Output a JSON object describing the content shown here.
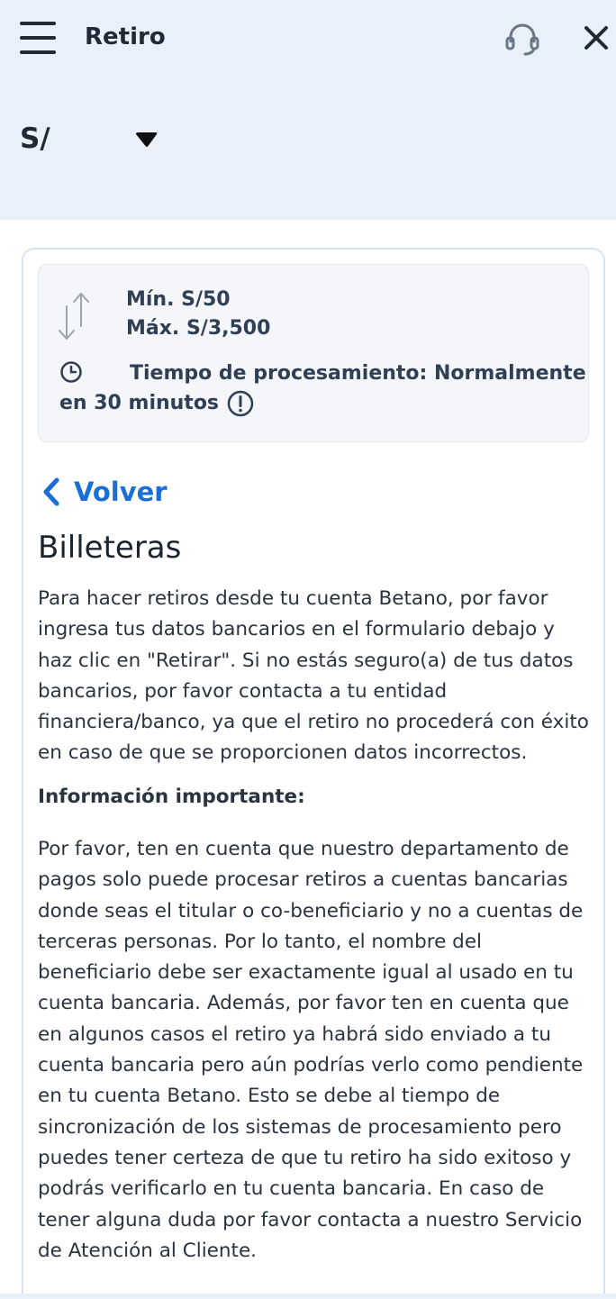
{
  "header": {
    "title": "Retiro",
    "currency": "S/",
    "menu_icon": "hamburger-menu-icon",
    "support_icon": "headset-icon",
    "close_icon": "close-icon"
  },
  "limits": {
    "min": "Mín. S/50",
    "max": "Máx. S/3,500",
    "processing": "Tiempo de procesamiento: Normalmente en 30 minutos"
  },
  "nav": {
    "back_label": "Volver"
  },
  "content": {
    "title": "Billeteras",
    "intro": "Para hacer retiros desde tu cuenta Betano, por favor ingresa tus datos bancarios en el formulario debajo y haz clic en \"Retirar\". Si no estás seguro(a) de tus datos bancarios, por favor contacta a tu entidad financiera/banco, ya que el retiro no procederá con éxito en caso de que se proporcionen datos incorrectos.",
    "important_title": "Información importante:",
    "important_body": "Por favor, ten en cuenta que nuestro departamento de pagos solo puede procesar retiros a cuentas bancarias donde seas el titular o co-beneficiario y no a cuentas de terceras personas. Por lo tanto, el nombre del beneficiario debe ser exactamente igual al usado en tu cuenta bancaria. Además, por favor ten en cuenta que en algunos casos el retiro ya habrá sido enviado a tu cuenta bancaria pero aún podrías verlo como pendiente en tu cuenta Betano. Esto se debe al tiempo de sincronización de los sistemas de procesamiento pero puedes tener certeza de que tu retiro ha sido exitoso y podrás verificarlo en tu cuenta bancaria. En caso de tener alguna duda por favor contacta a nuestro Servicio de Atención al Cliente."
  },
  "colors": {
    "header_bg": "#e9f0fa",
    "link_blue": "#1a6fd6",
    "text_dark": "#1c2430"
  }
}
